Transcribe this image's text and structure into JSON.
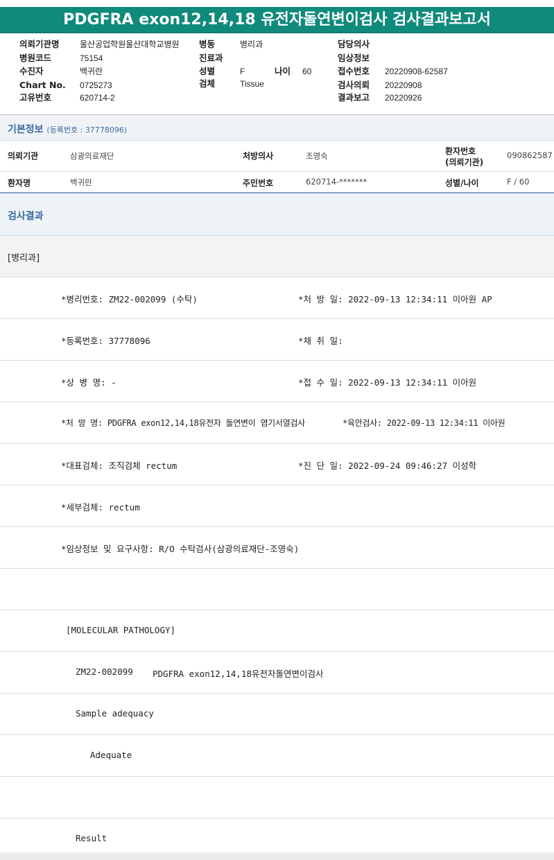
{
  "title": "PDGFRA exon12,14,18 유전자돌연변이검사 검사결과보고서",
  "header": {
    "col1": [
      {
        "label": "의뢰기관명",
        "value": "울산공업학원울산대학교병원"
      },
      {
        "label": "병원코드",
        "value": "75154"
      },
      {
        "label": "수진자",
        "value": "백귀란"
      },
      {
        "label": "Chart No.",
        "value": "0725273"
      },
      {
        "label": "고유번호",
        "value": "620714-2"
      }
    ],
    "col2": [
      {
        "label": "병동",
        "value": "병리과"
      },
      {
        "label": "진료과",
        "value": ""
      },
      {
        "label": "성별",
        "value": "F"
      },
      {
        "label": "검체",
        "value": "Tissue"
      }
    ],
    "age_label": "나이",
    "age_value": "60",
    "col3": [
      {
        "label": "담당의사",
        "value": ""
      },
      {
        "label": "임상정보",
        "value": ""
      },
      {
        "label": "접수번호",
        "value": "20220908-62587"
      },
      {
        "label": "검사의뢰",
        "value": "20220908"
      },
      {
        "label": "결과보고",
        "value": "20220926"
      }
    ]
  },
  "basic_info": {
    "heading": "기본정보",
    "reg_note": "(등록번호 : 37778096)",
    "row1": {
      "inst_label": "의뢰기관",
      "inst_value": "삼광의료재단",
      "doc_label": "처방의사",
      "doc_value": "조영숙",
      "pid_label_1": "환자번호",
      "pid_label_2": "(의뢰기관)",
      "pid_value": "090862587"
    },
    "row2": {
      "name_label": "환자명",
      "name_value": "백귀란",
      "rrn_label": "주민번호",
      "rrn_value": "620714-*******",
      "sexage_label": "성별/나이",
      "sexage_value": "F / 60"
    }
  },
  "results": {
    "heading": "검사결과",
    "dept": "[병리과]",
    "rows": [
      {
        "left": "*병리번호: ZM22-002099 (수탁)",
        "right": "*처 방 일: 2022-09-13 12:34:11  이아원 AP"
      },
      {
        "left": "*등록번호: 37778096",
        "right": "*채 취 일:"
      },
      {
        "left": "*상 병 명: -",
        "right": "*접 수 일: 2022-09-13 12:34:11  이아원"
      },
      {
        "left": "*처 방 명: PDGFRA exon12,14,18유전자 돌연변이 염기서열검사",
        "right": "*육안검사: 2022-09-13 12:34:11  이아원"
      },
      {
        "left": "*대표검체: 조직검체 rectum",
        "right": "*진 단 일: 2022-09-24 09:46:27  이성학"
      },
      {
        "left": "*세부검체: rectum",
        "right": ""
      },
      {
        "left": "*임상정보 및 요구사항: R/O 수탁검사(삼광의료재단-조영숙)",
        "right": ""
      }
    ],
    "molecular_heading": "[MOLECULAR PATHOLOGY]",
    "case_no": "ZM22-002099",
    "case_test": "PDGFRA exon12,14,18유전자돌연변이검사",
    "sample_label": "Sample adequacy",
    "sample_value": "Adequate",
    "result_label": "Result"
  }
}
